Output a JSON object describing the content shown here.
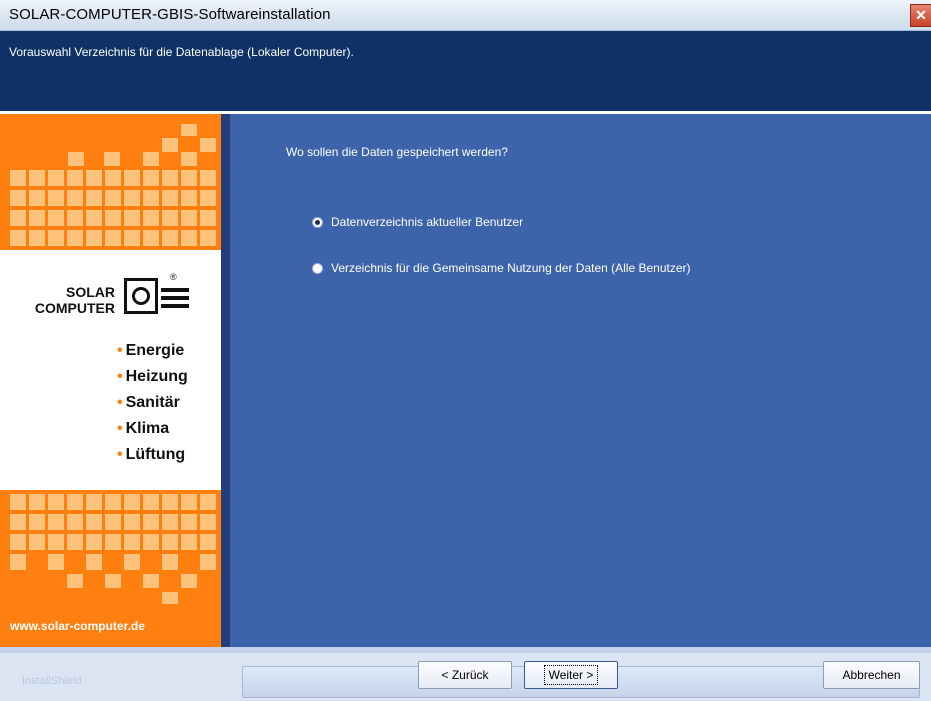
{
  "window": {
    "title": "SOLAR-COMPUTER-GBIS-Softwareinstallation",
    "close_glyph": "✕"
  },
  "header": {
    "subtitle": "Vorauswahl Verzeichnis für die Datenablage (Lokaler Computer)."
  },
  "sidebar": {
    "logo_line1": "SOLAR",
    "logo_line2": "COMPUTER",
    "logo_reg": "®",
    "features": [
      "Energie",
      "Heizung",
      "Sanitär",
      "Klima",
      "Lüftung"
    ],
    "url": "www.solar-computer.de",
    "colors": {
      "orange": "#ff7f10",
      "light_orange": "#ffc27a"
    }
  },
  "main": {
    "question": "Wo sollen die Daten gespeichert werden?",
    "options": [
      {
        "label": "Datenverzeichnis aktueller Benutzer",
        "selected": true
      },
      {
        "label": "Verzeichnis für die Gemeinsame Nutzung der Daten (Alle Benutzer)",
        "selected": false
      }
    ]
  },
  "footer": {
    "brand": "InstallShield",
    "back_button": "< Zurück",
    "next_button": "Weiter >",
    "cancel_button": "Abbrechen"
  }
}
